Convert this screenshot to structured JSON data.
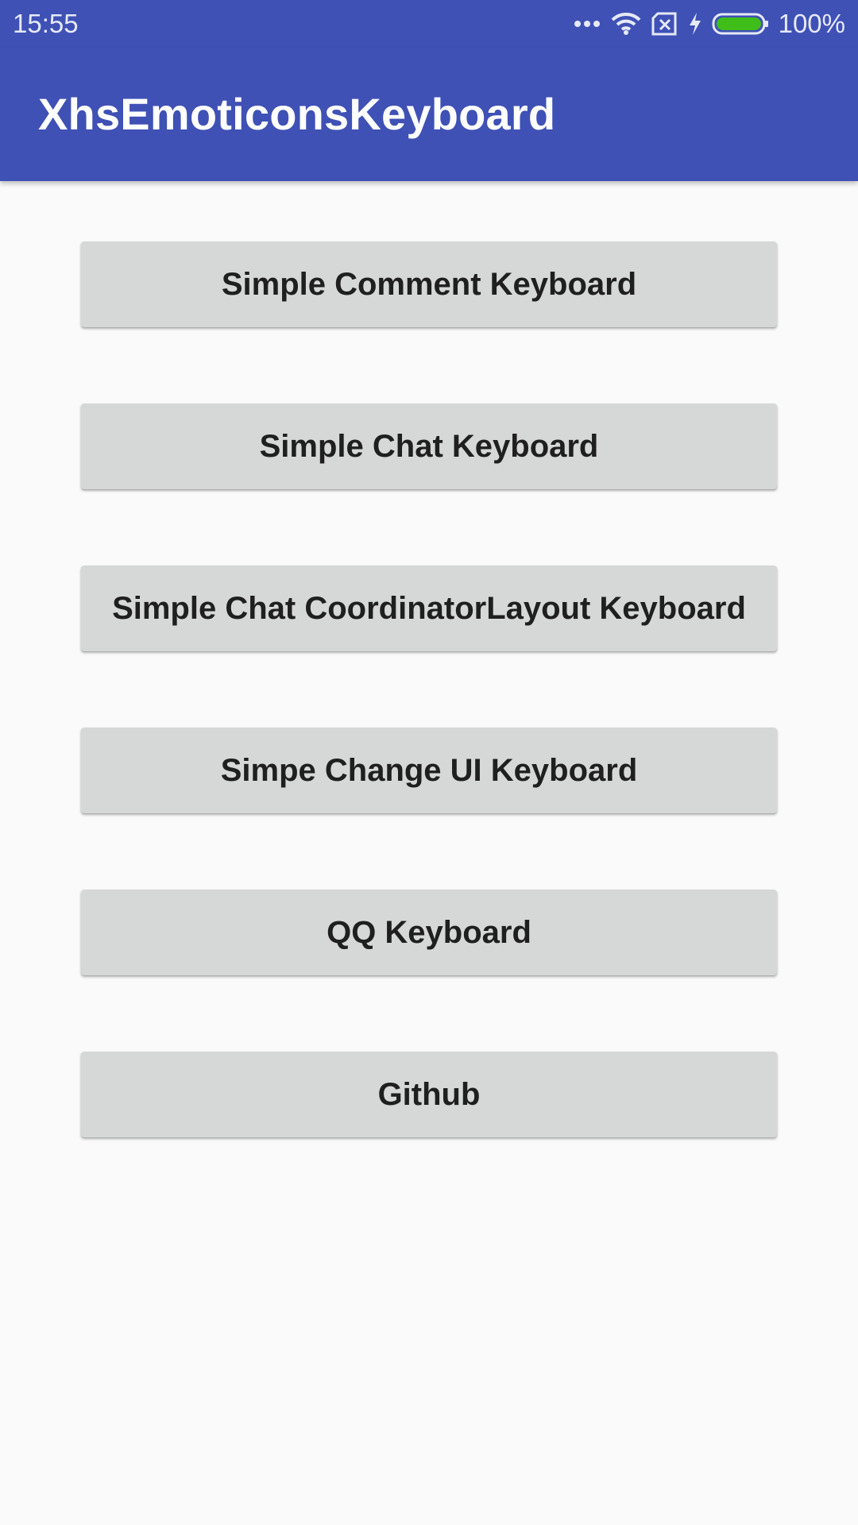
{
  "status_bar": {
    "time": "15:55",
    "battery": "100%",
    "icons": [
      "more-dots-icon",
      "wifi-icon",
      "no-sim-icon",
      "charging-icon",
      "battery-icon"
    ],
    "battery_color": "#3FBE1A"
  },
  "app_bar": {
    "title": "XhsEmoticonsKeyboard",
    "color": "#3F51B5"
  },
  "buttons": [
    {
      "label": "Simple Comment Keyboard"
    },
    {
      "label": "Simple Chat Keyboard"
    },
    {
      "label": "Simple Chat CoordinatorLayout Keyboard"
    },
    {
      "label": "Simpe Change UI Keyboard"
    },
    {
      "label": "QQ Keyboard"
    },
    {
      "label": "Github"
    }
  ]
}
